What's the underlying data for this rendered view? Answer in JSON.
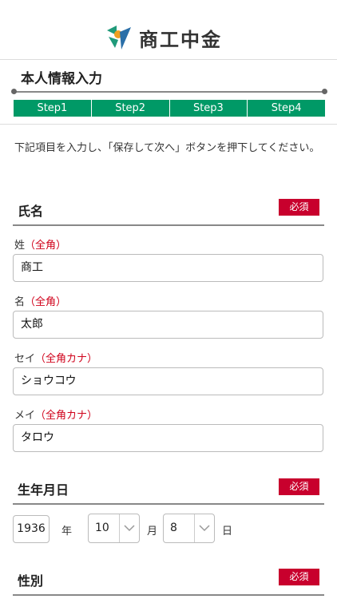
{
  "header": {
    "brand": "商工中金"
  },
  "page": {
    "title": "本人情報入力"
  },
  "steps": [
    "Step1",
    "Step2",
    "Step3",
    "Step4"
  ],
  "instruction": "下記項目を入力し、「保存して次へ」ボタンを押下してください。",
  "required_label": "必須",
  "name_section": {
    "title": "氏名",
    "fields": [
      {
        "label": "姓",
        "note": "（全角）",
        "value": "商工"
      },
      {
        "label": "名",
        "note": "（全角）",
        "value": "太郎"
      },
      {
        "label": "セイ",
        "note": "（全角カナ）",
        "value": "ショウコウ"
      },
      {
        "label": "メイ",
        "note": "（全角カナ）",
        "value": "タロウ"
      }
    ]
  },
  "birth_section": {
    "title": "生年月日",
    "year": "1936",
    "year_unit": "年",
    "month": "10",
    "month_unit": "月",
    "day": "8",
    "day_unit": "日"
  },
  "gender_section": {
    "title": "性別"
  },
  "colors": {
    "accent_green": "#009966",
    "required_red": "#c8002d",
    "note_red": "#d0021b"
  }
}
